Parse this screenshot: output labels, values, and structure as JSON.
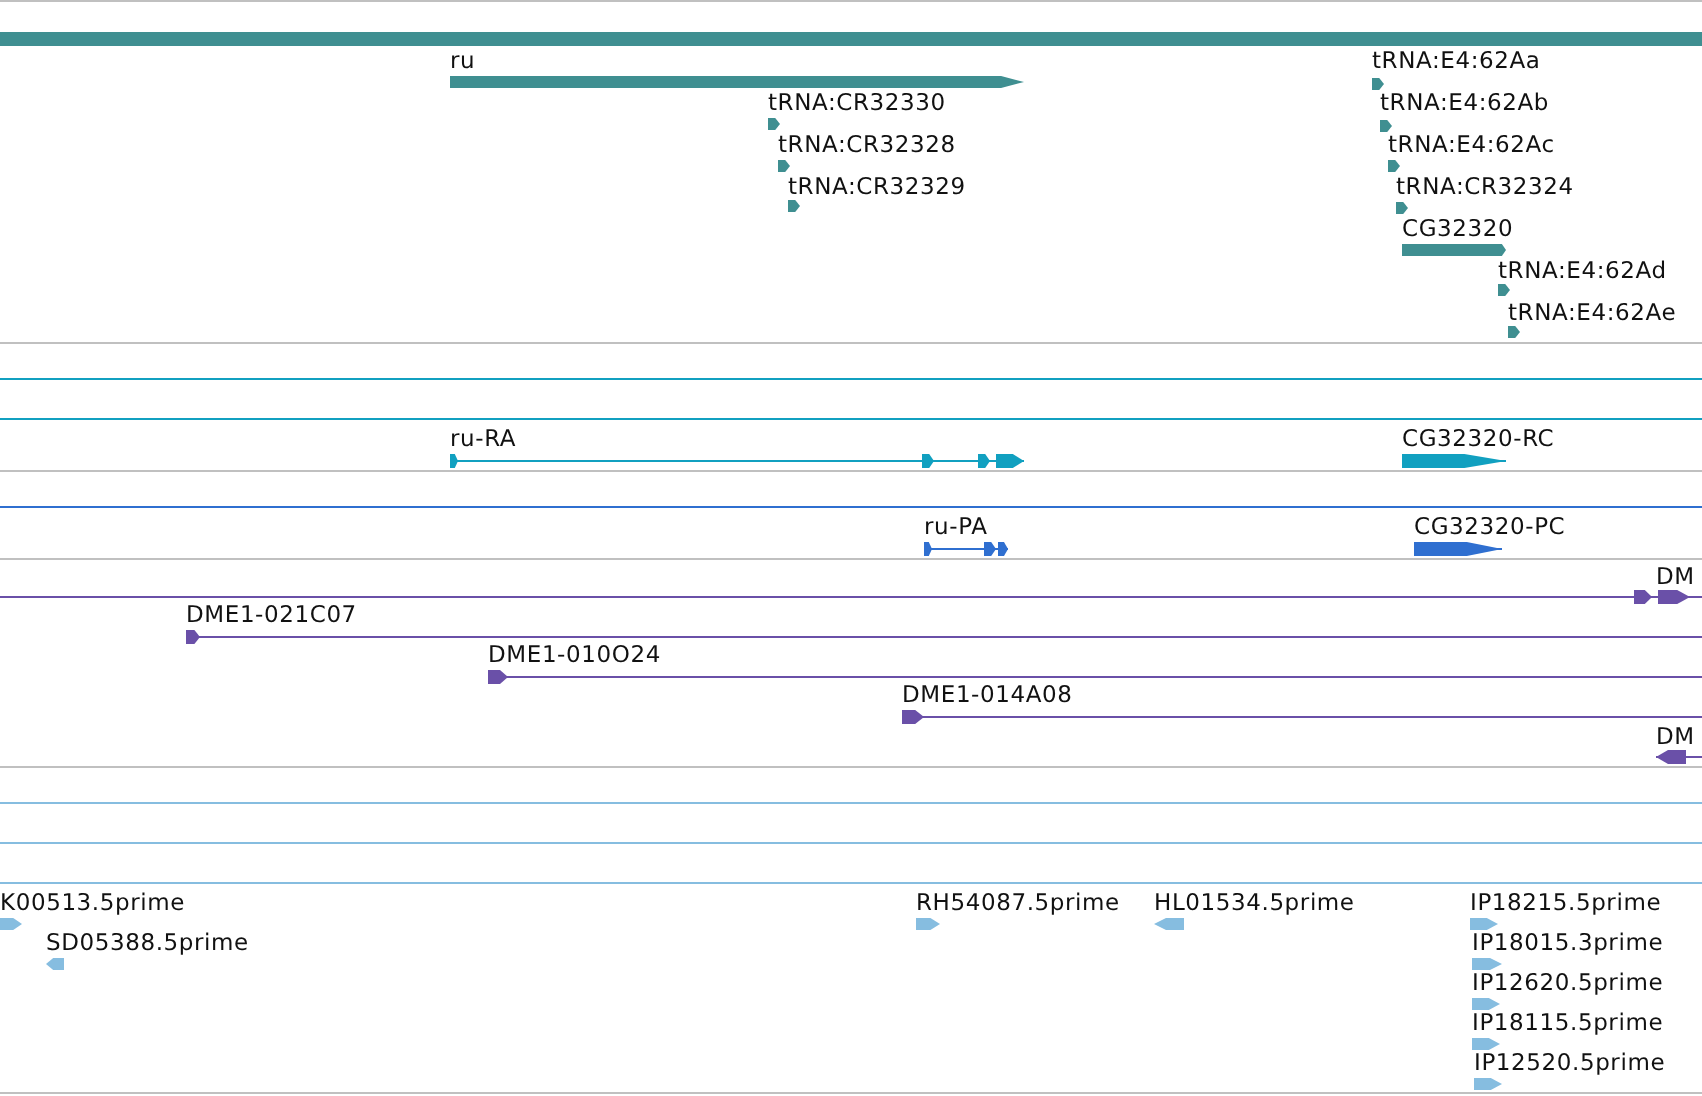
{
  "tracks": [
    {
      "kind": "gene",
      "color": "#3f8f91",
      "features": [
        {
          "label": "ru"
        },
        {
          "label": "tRNA:CR32330"
        },
        {
          "label": "tRNA:CR32328"
        },
        {
          "label": "tRNA:CR32329"
        },
        {
          "label": "tRNA:E4:62Aa"
        },
        {
          "label": "tRNA:E4:62Ab"
        },
        {
          "label": "tRNA:E4:62Ac"
        },
        {
          "label": "tRNA:CR32324"
        },
        {
          "label": "CG32320"
        },
        {
          "label": "tRNA:E4:62Ad"
        },
        {
          "label": "tRNA:E4:62Ae"
        }
      ]
    },
    {
      "kind": "transcript",
      "color": "#11a0c0",
      "features": [
        {
          "label": "ru-RA"
        },
        {
          "label": "CG32320-RC"
        }
      ]
    },
    {
      "kind": "transcript",
      "color": "#2f6fd0",
      "features": [
        {
          "label": "ru-PA"
        },
        {
          "label": "CG32320-PC"
        }
      ]
    },
    {
      "kind": "clone",
      "color": "#6a50a8",
      "features": [
        {
          "label": "DM",
          "reverse": false
        },
        {
          "label": "DME1-021C07",
          "reverse": false
        },
        {
          "label": "DME1-010O24",
          "reverse": false
        },
        {
          "label": "DME1-014A08",
          "reverse": false
        },
        {
          "label": "DM",
          "reverse": true
        }
      ]
    },
    {
      "kind": "est",
      "color": "#86bde0",
      "features": [
        {
          "label": "K00513.5prime",
          "reverse": false
        },
        {
          "label": "SD05388.5prime",
          "reverse": true
        },
        {
          "label": "RH54087.5prime",
          "reverse": false
        },
        {
          "label": "HL01534.5prime",
          "reverse": true
        },
        {
          "label": "IP18215.5prime",
          "reverse": false
        },
        {
          "label": "IP18015.3prime",
          "reverse": false
        },
        {
          "label": "IP12620.5prime",
          "reverse": false
        },
        {
          "label": "IP18115.5prime",
          "reverse": false
        },
        {
          "label": "IP12520.5prime",
          "reverse": false
        }
      ]
    }
  ]
}
